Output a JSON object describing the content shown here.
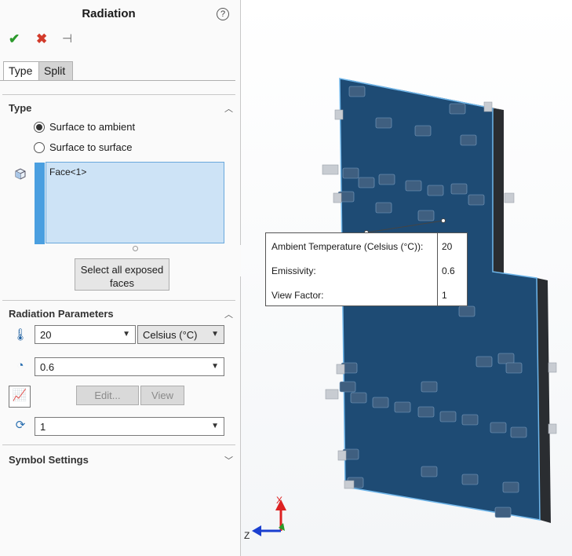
{
  "panel": {
    "title": "Radiation",
    "help_glyph": "?",
    "tabs": [
      "Type",
      "Split"
    ],
    "type_section": {
      "heading": "Type",
      "options": [
        "Surface to ambient",
        "Surface to surface"
      ],
      "selected_index": 0,
      "faces": [
        "Face<1>"
      ],
      "select_all_label_line1": "Select all exposed",
      "select_all_label_line2": "faces"
    },
    "params_section": {
      "heading": "Radiation Parameters",
      "temperature": "20",
      "unit": "Celsius (°C)",
      "emissivity": "0.6",
      "edit_label": "Edit...",
      "view_label": "View",
      "view_factor": "1"
    },
    "symbol_section": {
      "heading": "Symbol Settings"
    }
  },
  "callout": {
    "rows": [
      {
        "label": "Ambient Temperature (Celsius (°C)):",
        "value": "20"
      },
      {
        "label": "Emissivity:",
        "value": "0.6"
      },
      {
        "label": "View Factor:",
        "value": "1"
      }
    ]
  },
  "triad": {
    "x_label": "X",
    "z_label": "Z"
  },
  "colors": {
    "plate": "#1e4b74",
    "selection": "#4a9fe0",
    "ok": "#2c9a2c",
    "cancel": "#d23a2a"
  }
}
